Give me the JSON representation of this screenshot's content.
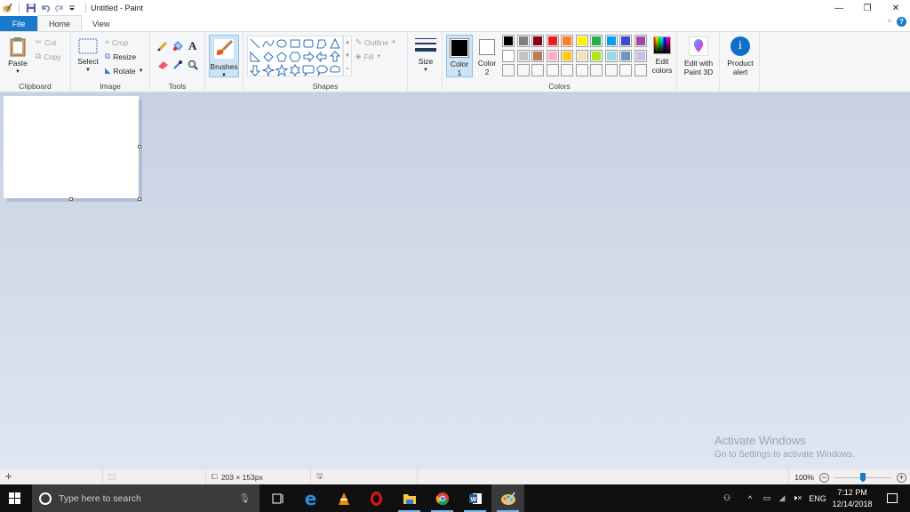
{
  "window": {
    "title": "Untitled - Paint",
    "controls": {
      "minimize": "—",
      "restore": "❐",
      "close": "✕"
    }
  },
  "quick_access": {
    "icons": [
      "paint-app-icon",
      "save-icon",
      "undo-icon",
      "redo-icon",
      "customize-dropdown-icon"
    ]
  },
  "tabs": [
    {
      "label": "File",
      "active": false
    },
    {
      "label": "Home",
      "active": true
    },
    {
      "label": "View",
      "active": false
    }
  ],
  "help": {
    "collapse": "^",
    "help": "?"
  },
  "ribbon": {
    "clipboard": {
      "label": "Clipboard",
      "paste": "Paste",
      "cut": "Cut",
      "copy": "Copy"
    },
    "image": {
      "label": "Image",
      "select": "Select",
      "crop": "Crop",
      "resize": "Resize",
      "rotate": "Rotate"
    },
    "tools": {
      "label": "Tools",
      "items": [
        "pencil",
        "fill",
        "text",
        "eraser",
        "color-picker",
        "magnifier"
      ]
    },
    "brushes": {
      "label": "Brushes"
    },
    "shapes": {
      "label": "Shapes",
      "outline": "Outline",
      "fill": "Fill",
      "items": [
        "line",
        "curve",
        "oval",
        "rectangle",
        "rounded-rectangle",
        "polygon",
        "triangle",
        "right-triangle",
        "diamond",
        "pentagon",
        "hexagon",
        "right-arrow",
        "left-arrow",
        "up-arrow",
        "down-arrow",
        "four-point-star",
        "five-point-star",
        "six-point-star",
        "rounded-callout",
        "oval-callout",
        "cloud-callout"
      ]
    },
    "size": {
      "label": "Size"
    },
    "colors": {
      "label": "Colors",
      "color1": {
        "label": "Color",
        "num": "1",
        "value": "#000000"
      },
      "color2": {
        "label": "Color",
        "num": "2",
        "value": "#ffffff"
      },
      "palette_row1": [
        "#000000",
        "#7f7f7f",
        "#880015",
        "#ed1c24",
        "#ff7f27",
        "#fff200",
        "#22b14c",
        "#00a2e8",
        "#3f48cc",
        "#a349a4"
      ],
      "palette_row2": [
        "#ffffff",
        "#c3c3c3",
        "#b97a57",
        "#ffaec9",
        "#ffc90e",
        "#efe4b0",
        "#b5e61d",
        "#99d9ea",
        "#7092be",
        "#c8bfe7"
      ],
      "palette_row3": [
        "",
        "",
        "",
        "",
        "",
        "",
        "",
        "",
        "",
        ""
      ],
      "edit_colors": [
        "Edit",
        "colors"
      ]
    },
    "paint3d": [
      "Edit with",
      "Paint 3D"
    ],
    "product_alert": [
      "Product",
      "alert"
    ]
  },
  "watermark": {
    "title": "Activate Windows",
    "subtitle": "Go to Settings to activate Windows."
  },
  "status": {
    "position": "",
    "selection": "",
    "canvas_size": "203 × 153px",
    "zoom": "100%",
    "zoom_level": 0.5
  },
  "taskbar": {
    "search_placeholder": "Type here to search",
    "apps": [
      "task-view",
      "edge",
      "vlc",
      "opera",
      "file-explorer",
      "chrome",
      "word",
      "paint"
    ],
    "language": "ENG",
    "time": "7:12 PM",
    "date": "12/14/2018"
  }
}
